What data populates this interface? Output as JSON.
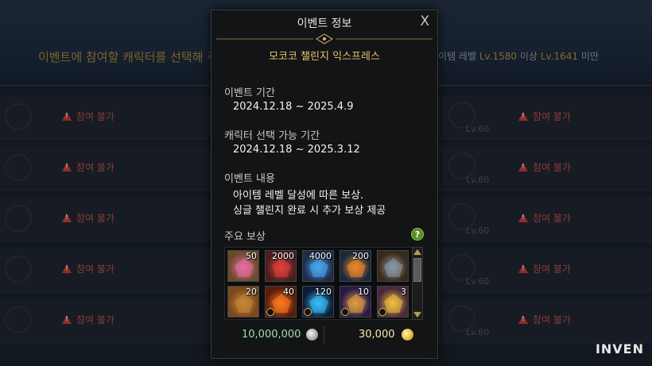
{
  "background": {
    "banner_text": "이벤트에 참여할 캐릭터를 선택해 주세요",
    "level_req": {
      "prefix": "아이템 레벨",
      "min": "Lv.1580",
      "min_suffix": "이상",
      "max": "Lv.1641",
      "max_suffix": "미만"
    },
    "rows": [
      {
        "left_status": "참여 불가",
        "right_status": "참여 불가",
        "right_lv": "Lv.60"
      },
      {
        "left_status": "참여 불가",
        "right_status": "참여 불가",
        "right_lv": "Lv.60"
      },
      {
        "left_status": "참여 불가",
        "right_status": "참여 불가",
        "right_lv": "Lv.60"
      },
      {
        "left_status": "참여 불가",
        "right_status": "참여 불가",
        "right_lv": "Lv.60"
      },
      {
        "left_status": "참여 불가",
        "right_status": "참여 불가",
        "right_lv": "Lv.60"
      }
    ],
    "watermark": "INVEN"
  },
  "dialog": {
    "title": "이벤트 정보",
    "close": "X",
    "event_name": "모코코 챌린지 익스프레스",
    "period_label": "이벤트 기간",
    "period_value": "2024.12.18 ~ 2025.4.9",
    "select_label": "캐릭터 선택 가능 기간",
    "select_value": "2024.12.18 ~ 2025.3.12",
    "content_label": "이벤트 내용",
    "content_lines": [
      "아이템 레벨 달성에 따른 보상.",
      "싱글 챌린지 완료 시 추가 보상 제공"
    ],
    "rewards_label": "주요 보상",
    "help": "?",
    "rewards": [
      {
        "count": "50",
        "icon": "pouch-icon",
        "color": "#6b4a2c",
        "accent": "#e86fa0"
      },
      {
        "count": "2000",
        "icon": "red-crystal-icon",
        "color": "#4a1e22",
        "accent": "#e0403a"
      },
      {
        "count": "4000",
        "icon": "blue-crystal-icon",
        "color": "#1e2c4a",
        "accent": "#4aa8f0"
      },
      {
        "count": "200",
        "icon": "fire-gem-icon",
        "color": "#1a2a3c",
        "accent": "#f08a28"
      },
      {
        "count": "",
        "icon": "chest-icon",
        "color": "#3a2a1c",
        "accent": "#8a9aa8"
      },
      {
        "count": "20",
        "icon": "bag-icon",
        "color": "#7a4a1c",
        "accent": "#c8863a"
      },
      {
        "count": "40",
        "icon": "orange-orb-icon",
        "color": "#5a1c0c",
        "accent": "#ff7a20",
        "bound": true
      },
      {
        "count": "120",
        "icon": "blue-orb-icon",
        "color": "#0c1c3a",
        "accent": "#38c0f8",
        "bound": true
      },
      {
        "count": "10",
        "icon": "purple-card-icon",
        "color": "#2a1a4a",
        "accent": "#e0a040",
        "bound": true
      },
      {
        "count": "3",
        "icon": "gold-card-icon",
        "color": "#4a2a3a",
        "accent": "#f0c040",
        "bound": true
      }
    ],
    "silver": "10,000,000",
    "gold": "30,000"
  }
}
